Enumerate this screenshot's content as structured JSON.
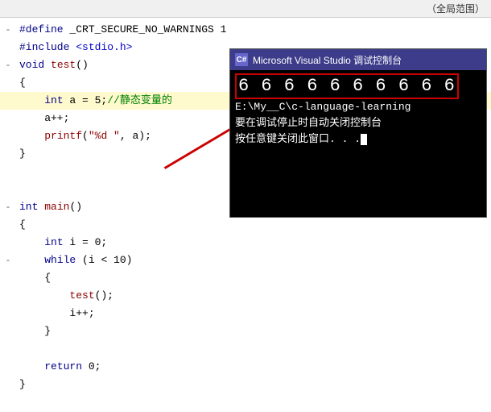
{
  "topbar": {
    "label": "（全局范围）"
  },
  "code": {
    "lines": [
      {
        "indent": 0,
        "gutter": "minus",
        "content": "#define _CRT_SECURE_NO_WARNINGS 1",
        "type": "preprocessor"
      },
      {
        "indent": 0,
        "gutter": "none",
        "content": "#include <stdio.h>",
        "type": "include"
      },
      {
        "indent": 0,
        "gutter": "minus",
        "content": "void test()",
        "type": "function_decl"
      },
      {
        "indent": 0,
        "gutter": "none",
        "content": "{",
        "type": "brace"
      },
      {
        "indent": 2,
        "gutter": "none",
        "content": "    int a = 5;//静态变量的",
        "type": "statement"
      },
      {
        "indent": 2,
        "gutter": "none",
        "content": "    a++;",
        "type": "statement"
      },
      {
        "indent": 2,
        "gutter": "none",
        "content": "    printf(\"%d \", a);",
        "type": "statement"
      },
      {
        "indent": 0,
        "gutter": "none",
        "content": "}",
        "type": "brace"
      },
      {
        "indent": 0,
        "gutter": "none",
        "content": "",
        "type": "empty"
      },
      {
        "indent": 0,
        "gutter": "none",
        "content": "",
        "type": "empty"
      },
      {
        "indent": 0,
        "gutter": "minus",
        "content": "int main()",
        "type": "function_decl"
      },
      {
        "indent": 0,
        "gutter": "none",
        "content": "{",
        "type": "brace"
      },
      {
        "indent": 2,
        "gutter": "none",
        "content": "    int i = 0;",
        "type": "statement"
      },
      {
        "indent": 2,
        "gutter": "minus2",
        "content": "    while (i < 10)",
        "type": "statement"
      },
      {
        "indent": 2,
        "gutter": "none",
        "content": "    {",
        "type": "brace"
      },
      {
        "indent": 4,
        "gutter": "none",
        "content": "        test();",
        "type": "statement"
      },
      {
        "indent": 4,
        "gutter": "none",
        "content": "        i++;",
        "type": "statement"
      },
      {
        "indent": 2,
        "gutter": "none",
        "content": "    }",
        "type": "brace"
      },
      {
        "indent": 0,
        "gutter": "none",
        "content": "",
        "type": "empty"
      },
      {
        "indent": 2,
        "gutter": "none",
        "content": "    return 0;",
        "type": "statement"
      },
      {
        "indent": 0,
        "gutter": "none",
        "content": "}",
        "type": "brace"
      }
    ]
  },
  "console": {
    "title": "Microsoft Visual Studio 调试控制台",
    "icon_label": "C#",
    "numbers_output": "6 6 6 6 6 6 6 6 6 6",
    "path_line": "E:\\My__C\\c-language-learning",
    "info_line1": "要在调试停止时自动关闭控制台",
    "info_line2": "按任意键关闭此窗口. . ."
  }
}
